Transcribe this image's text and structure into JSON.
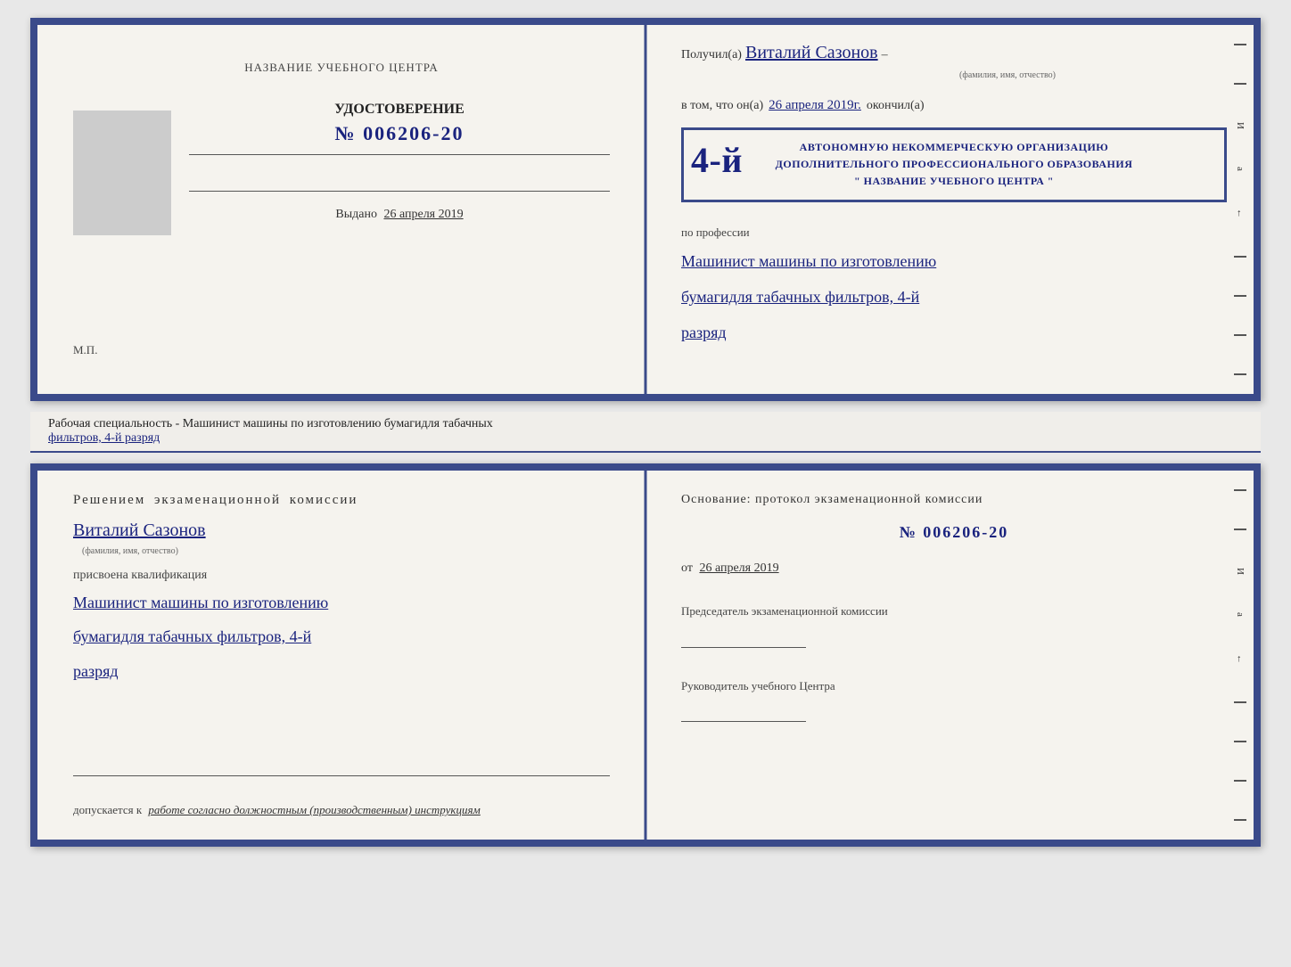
{
  "top_cert": {
    "left": {
      "title_label": "НАЗВАНИЕ УЧЕБНОГО ЦЕНТРА",
      "doc_title": "УДОСТОВЕРЕНИЕ",
      "doc_number": "№ 006206-20",
      "issued_label": "Выдано",
      "issued_date": "26 апреля 2019",
      "mp_label": "М.П."
    },
    "right": {
      "received_prefix": "Получил(а)",
      "recipient_name": "Виталий Сазонов",
      "fio_subtitle": "(фамилия, имя, отчество)",
      "vtom_prefix": "в том, что он(а)",
      "vtom_date": "26 апреля 2019г.",
      "vtom_suffix": "окончил(а)",
      "stamp_line1": "АВТОНОМНУЮ НЕКОММЕРЧЕСКУЮ ОРГАНИЗАЦИЮ",
      "stamp_line2": "ДОПОЛНИТЕЛЬНОГО ПРОФЕССИОНАЛЬНОГО ОБРАЗОВАНИЯ",
      "stamp_line3": "\" НАЗВАНИЕ УЧЕБНОГО ЦЕНТРА \"",
      "stamp_large": "4-й",
      "profession_prefix": "по профессии",
      "profession_line1": "Машинист машины по изготовлению",
      "profession_line2": "бумагидля табачных фильтров, 4-й",
      "profession_line3": "разряд"
    }
  },
  "desc_bar": {
    "text_prefix": "Рабочая специальность - Машинист машины по изготовлению бумагидля табачных",
    "text_underlined": "фильтров, 4-й разряд"
  },
  "bottom_cert": {
    "left": {
      "commission_title": "Решением  экзаменационной  комиссии",
      "recipient_name": "Виталий Сазонов",
      "fio_subtitle": "(фамилия, имя, отчество)",
      "assigned_label": "присвоена квалификация",
      "qual_line1": "Машинист машины по изготовлению",
      "qual_line2": "бумагидля табачных фильтров, 4-й",
      "qual_line3": "разряд",
      "allowed_prefix": "допускается к",
      "allowed_italic": "работе согласно должностным (производственным) инструкциям"
    },
    "right": {
      "osnov_label": "Основание:  протокол  экзаменационной  комиссии",
      "protocol_number": "№  006206-20",
      "from_prefix": "от",
      "from_date": "26 апреля 2019",
      "chairman_label": "Председатель экзаменационной комиссии",
      "director_label": "Руководитель учебного Центра"
    }
  },
  "side_chars": {
    "char1": "И",
    "char2": "а",
    "char3": "←"
  }
}
